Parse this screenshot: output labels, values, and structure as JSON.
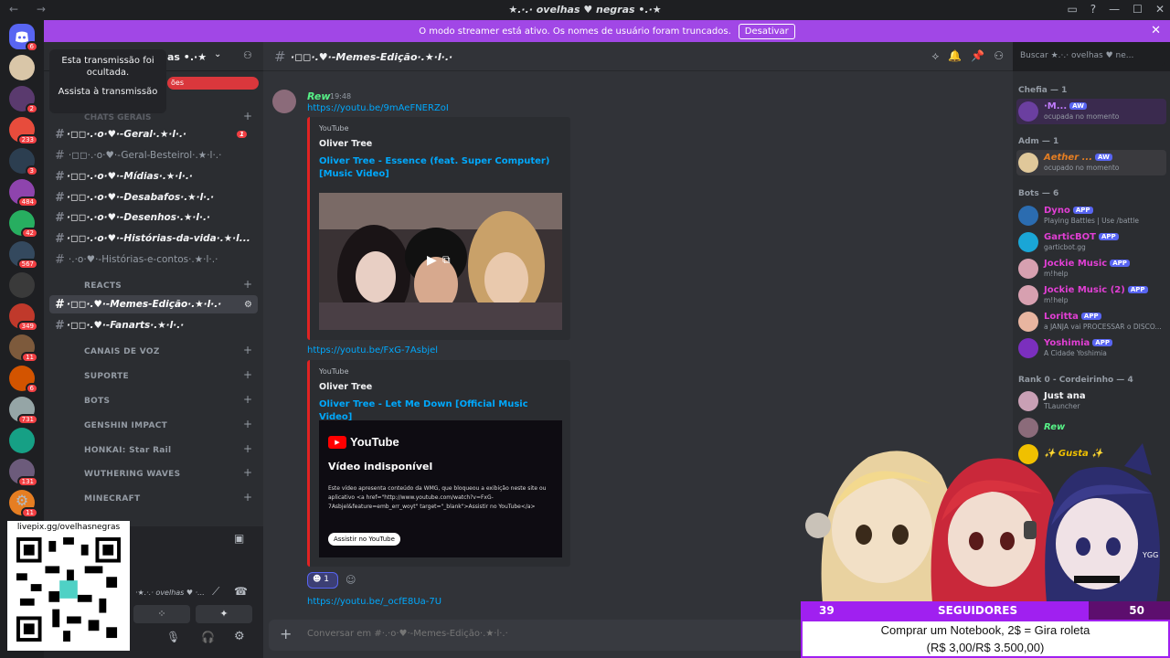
{
  "window": {
    "title": "★.·.· ovelhas ♥ negras •.·★",
    "nav": "← →"
  },
  "banner": {
    "text": "O modo streamer está ativo. Os nomes de usuário foram truncados.",
    "button": "Desativar"
  },
  "guild_badges": [
    "6",
    "2",
    "233",
    "3",
    "484",
    "42",
    "567",
    "349",
    "11",
    "6",
    "731",
    "131",
    "11"
  ],
  "sidebar": {
    "server_name": "as •.·★",
    "popup_title": "Esta transmissão foi ocultada.",
    "popup_link": "Assista à transmissão",
    "red_pill": "ões",
    "categories": [
      "REACTS",
      "CANAIS DE VOZ",
      "SUPORTE",
      "BOTS",
      "GENSHIN IMPACT",
      "HONKAI: Star Rail",
      "WUTHERING WAVES",
      "MINECRAFT"
    ],
    "channels": [
      {
        "name": "·◻◻·.·o·♥·-Geral·.★·l·.·",
        "badge": "1"
      },
      {
        "name": "·◻◻·.·o·♥·-Geral-Besteirol·.★·l·.·"
      },
      {
        "name": "·◻◻·.·o·♥·-Mídias·.★·l·.·"
      },
      {
        "name": "·◻◻·.·o·♥·-Desabafos·.★·l·.·"
      },
      {
        "name": "·◻◻·.·o·♥·-Desenhos·.★·l·.·"
      },
      {
        "name": "·◻◻·.·o·♥·-Histórias-da-vida·.★·l..."
      },
      {
        "name": "·.·o·♥·-Histórias-e-contos·.★·l·.·"
      },
      {
        "name": "·◻◻·.♥·-Memes-Edição·.★·l·.·"
      },
      {
        "name": "·◻◻·.♥·-Fanarts·.★·l·.·"
      }
    ]
  },
  "qr": {
    "label": "livepix.gg/ovelhasnegras"
  },
  "chat": {
    "channel": "·◻◻·.♥·-Memes-Edição·.★·l·.·",
    "search_placeholder": "Buscar ★.·.· ovelhas ♥ ne...",
    "author": "Rew",
    "time": "19:48",
    "messages": [
      {
        "link": "https://youtu.be/9mAeFNERZoI",
        "provider": "YouTube",
        "embed_author": "Oliver Tree",
        "embed_title": "Oliver Tree - Essence (feat. Super Computer) [Music Video]"
      },
      {
        "link": "https://youtu.be/FxG-7Asbjel",
        "provider": "YouTube",
        "embed_author": "Oliver Tree",
        "embed_title": "Oliver Tree - Let Me Down [Official Music Video]",
        "yt_logo": "YouTube",
        "yt_heading": "Vídeo indisponível",
        "yt_body": "Este vídeo apresenta conteúdo da WMG, que bloqueou a exibição neste site ou aplicativo <a href=\"http://www.youtube.com/watch?v=FxG-7Asbjel&feature=emb_err_woyt\" target=\"_blank\">Assistir no YouTube</a>",
        "yt_button": "Assistir no YouTube"
      },
      {
        "link": "https://youtu.be/_ocfE8Ua-7U"
      }
    ],
    "reaction_count": "1",
    "composer_placeholder": "Conversar em #·.·o·♥·-Memes-Edição·.★·l·.·"
  },
  "members": {
    "groups": [
      {
        "title": "Chefia — 1",
        "items": [
          {
            "name": "·M...",
            "sub": "ocupada no momento",
            "tag": "AW",
            "color": "#c27cff"
          }
        ]
      },
      {
        "title": "Adm — 1",
        "items": [
          {
            "name": "Aether ...",
            "sub": "ocupado no momento",
            "tag": "AW",
            "color": "#e67e22"
          }
        ]
      },
      {
        "title": "Bots — 6",
        "items": [
          {
            "name": "Dyno",
            "sub": "Playing Battles | Use /battle",
            "tag": "APP",
            "color": "#e13fd4"
          },
          {
            "name": "GarticBOT",
            "sub": "garticbot.gg",
            "tag": "APP",
            "color": "#e13fd4"
          },
          {
            "name": "Jockie Music",
            "sub": "m!help",
            "tag": "APP",
            "color": "#e13fd4"
          },
          {
            "name": "Jockie Music (2)",
            "sub": "m!help",
            "tag": "APP",
            "color": "#e13fd4"
          },
          {
            "name": "Loritta",
            "sub": "a JANJA vai PROCESSAR o DISCO...",
            "tag": "APP",
            "color": "#e13fd4"
          },
          {
            "name": "Yoshimia",
            "sub": "A Cidade Yoshimia",
            "tag": "APP",
            "color": "#e13fd4"
          }
        ]
      },
      {
        "title": "Rank 0 - Cordeirinho — 4",
        "items": [
          {
            "name": "Just ana",
            "sub": "TLauncher",
            "tag": "",
            "color": "#f2f3f5"
          },
          {
            "name": "Rew",
            "sub": "",
            "tag": "",
            "color": "#57f287"
          },
          {
            "name": "✨ Gusta ✨",
            "sub": "",
            "tag": "",
            "color": "#f0c000"
          }
        ]
      }
    ]
  },
  "overlay": {
    "followers_current": "39",
    "followers_label": "SEGUIDORES",
    "followers_goal": "50",
    "followers_progress": 0.78,
    "roleta_line1": "Comprar um Notebook, 2$ = Gira roleta",
    "roleta_line2": "(R$ 3,00/R$ 3.500,00)",
    "ygg": "YGG"
  },
  "colors": {
    "banner": "#a147e6",
    "accent": "#5865f2",
    "link": "#00a8fc",
    "mention_red": "#f23f43"
  }
}
